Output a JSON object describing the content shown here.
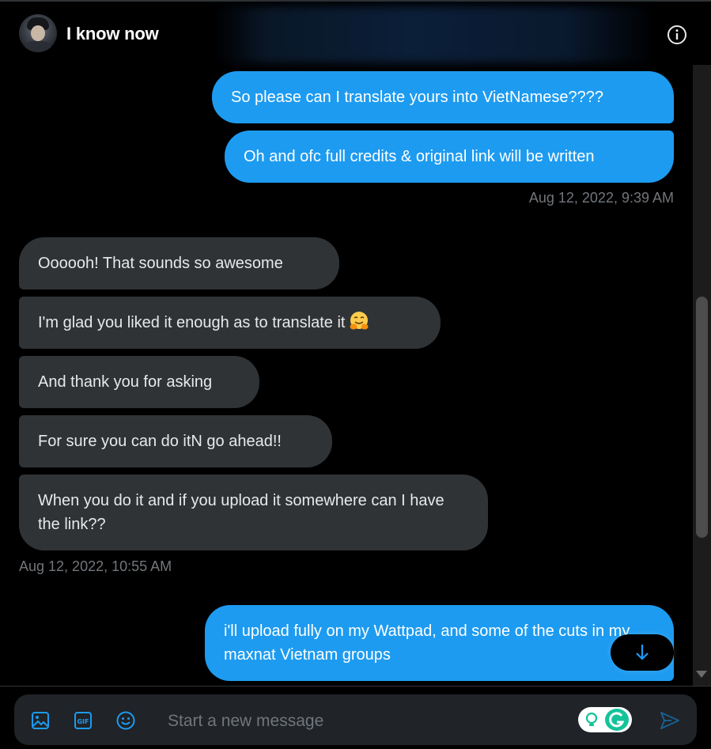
{
  "header": {
    "title": "I know now"
  },
  "messages": [
    {
      "direction": "outgoing",
      "text": "So please can I translate yours into VietNamese????"
    },
    {
      "direction": "outgoing",
      "text": "Oh and ofc full credits & original link will be written"
    },
    {
      "timestamp": "Aug 12, 2022, 9:39 AM"
    },
    {
      "direction": "incoming",
      "text": "Oooooh! That sounds so awesome"
    },
    {
      "direction": "incoming",
      "text": "I'm glad you liked it enough as to translate it",
      "emoji": "hugging-face"
    },
    {
      "direction": "incoming",
      "text": "And thank you for asking"
    },
    {
      "direction": "incoming",
      "text": "For sure you can do itN go ahead!!"
    },
    {
      "direction": "incoming",
      "text": "When you do it and if you upload it somewhere can I have the link??"
    },
    {
      "timestamp": "Aug 12, 2022, 10:55 AM"
    },
    {
      "direction": "outgoing",
      "text": "i'll upload fully on my Wattpad, and some of the cuts in my maxnat Vietnam groups"
    }
  ],
  "composer": {
    "placeholder": "Start a new message"
  },
  "icons": {
    "header": [
      "info-icon"
    ],
    "composer": [
      "image-icon",
      "gif-icon",
      "emoji-icon",
      "grammarly-icon",
      "send-icon"
    ],
    "scroll": "arrow-down-icon"
  },
  "colors": {
    "accent": "#1d9bf0",
    "incoming_bubble": "#2f3336",
    "background": "#000000",
    "muted_text": "#71767b"
  }
}
